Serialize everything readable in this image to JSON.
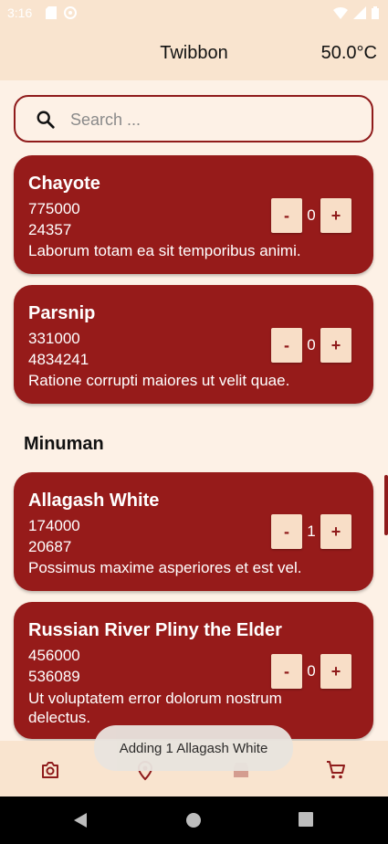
{
  "status_bar": {
    "time": "3:16"
  },
  "app_bar": {
    "title": "Twibbon",
    "temperature": "50.0°C"
  },
  "search": {
    "placeholder": "Search ..."
  },
  "items": [
    {
      "name": "Chayote",
      "line1": "775000",
      "line2": "24357",
      "description": "Laborum totam ea sit temporibus animi.",
      "quantity": "0",
      "minus": "-",
      "plus": "+"
    },
    {
      "name": "Parsnip",
      "line1": "331000",
      "line2": "4834241",
      "description": "Ratione corrupti maiores ut velit quae.",
      "quantity": "0",
      "minus": "-",
      "plus": "+"
    },
    {
      "name": "Allagash White",
      "line1": "174000",
      "line2": "20687",
      "description": "Possimus maxime asperiores et est vel.",
      "quantity": "1",
      "minus": "-",
      "plus": "+"
    },
    {
      "name": "Russian River Pliny the Elder",
      "line1": "456000",
      "line2": "536089",
      "description": "Ut voluptatem error dolorum nostrum delectus.",
      "quantity": "0",
      "minus": "-",
      "plus": "+"
    }
  ],
  "section_header": "Minuman",
  "toast": {
    "message": "Adding 1 Allagash White"
  },
  "bottom_nav": [
    {
      "icon": "camera-icon"
    },
    {
      "icon": "location-icon"
    },
    {
      "icon": "store-icon"
    },
    {
      "icon": "cart-icon"
    }
  ],
  "colors": {
    "card": "#961b1a",
    "accent": "#8f1b1b",
    "bar": "#f9e4cf",
    "background": "#fdf1e6",
    "button": "#f8dec7"
  }
}
